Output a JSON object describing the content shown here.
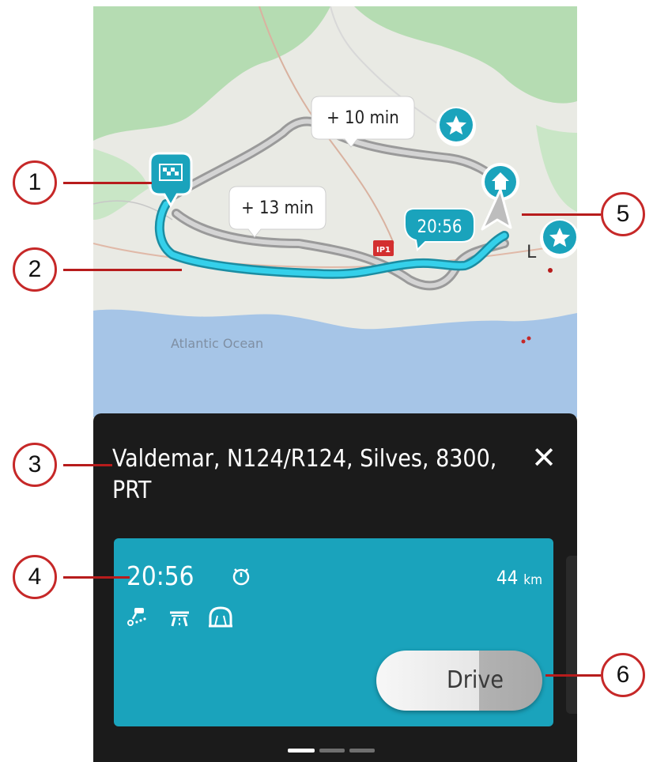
{
  "map": {
    "ocean_label": "Atlantic Ocean",
    "road_shield": "IP1",
    "alt_route_1_delay": "+ 10 min",
    "alt_route_2_delay": "+ 13 min",
    "route_eta_bubble": "20:56",
    "town_label": "L",
    "colors": {
      "route_primary": "#2fc3de",
      "route_alt": "#b8b8b8",
      "ocean": "#a5c4e6",
      "land": "#e9eae4",
      "forest": "#a8d7a8",
      "marker": "#1aa3bc"
    }
  },
  "panel": {
    "destination": "Valdemar, N124/R124, Silves, 8300, PRT",
    "close_label": "✕",
    "route_card": {
      "arrival_time": "20:56",
      "distance_value": "44",
      "distance_unit": "km",
      "icons": [
        "traffic-camera-icon",
        "motorway-icon",
        "tunnel-icon",
        "timer-icon"
      ]
    },
    "drive_button_label": "Drive",
    "pager": {
      "pages": 3,
      "active": 1
    }
  },
  "callouts": [
    "1",
    "2",
    "3",
    "4",
    "5",
    "6"
  ]
}
